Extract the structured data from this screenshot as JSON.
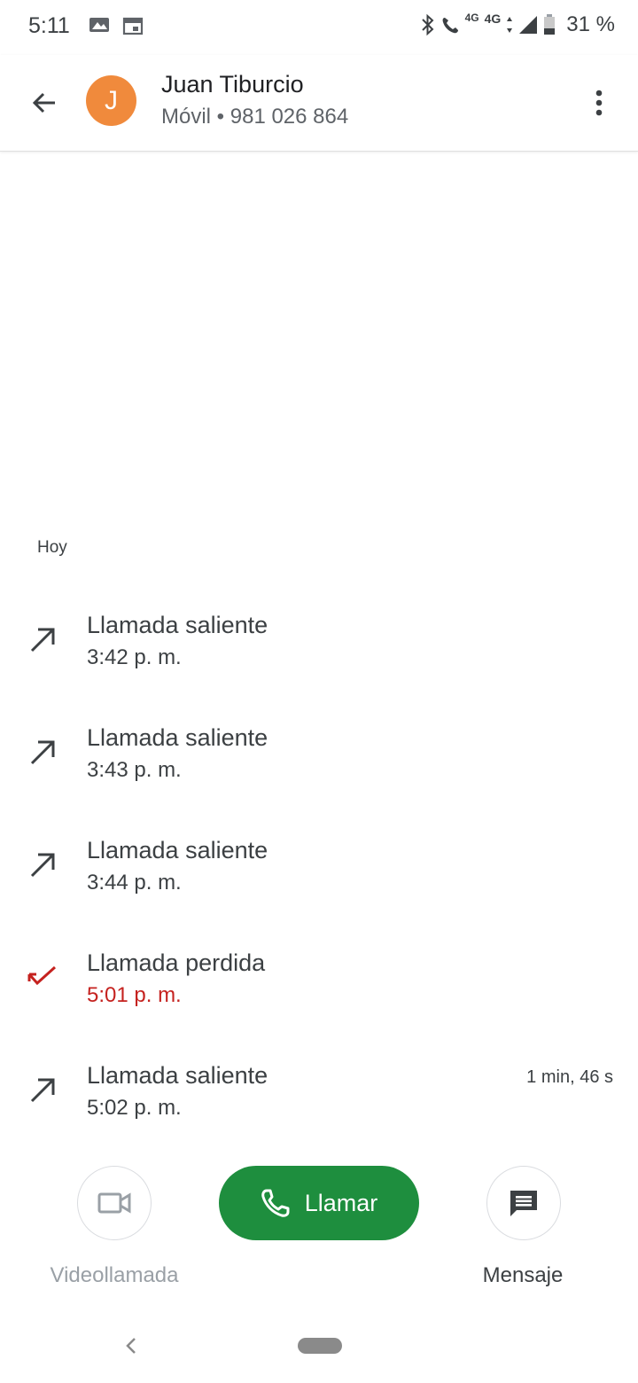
{
  "status_bar": {
    "time": "5:11",
    "battery_percent": "31 %",
    "small_network": "4G",
    "network": "4G",
    "icons": [
      "gallery-icon",
      "calendar-icon",
      "bluetooth-icon",
      "volte-call-icon",
      "signal-icon",
      "battery-icon"
    ]
  },
  "header": {
    "avatar_letter": "J",
    "avatar_color": "#f08a3c",
    "contact_name": "Juan Tiburcio",
    "contact_subtitle": "Móvil • 981 026 864"
  },
  "history": {
    "section_label": "Hoy",
    "calls": [
      {
        "type": "Llamada saliente",
        "time": "3:42 p. m.",
        "kind": "outgoing",
        "duration": ""
      },
      {
        "type": "Llamada saliente",
        "time": "3:43 p. m.",
        "kind": "outgoing",
        "duration": ""
      },
      {
        "type": "Llamada saliente",
        "time": "3:44 p. m.",
        "kind": "outgoing",
        "duration": ""
      },
      {
        "type": "Llamada perdida",
        "time": "5:01 p. m.",
        "kind": "missed",
        "duration": ""
      },
      {
        "type": "Llamada saliente",
        "time": "5:02 p. m.",
        "kind": "outgoing",
        "duration": "1 min, 46 s"
      }
    ]
  },
  "actions": {
    "video_label": "Videollamada",
    "call_label": "Llamar",
    "message_label": "Mensaje",
    "call_color": "#1e8e3e",
    "missed_color": "#c5221f"
  }
}
